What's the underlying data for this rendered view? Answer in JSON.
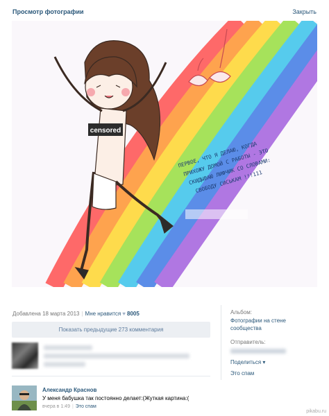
{
  "header": {
    "title": "Просмотр фотографии",
    "close_label": "Закрыть"
  },
  "photo": {
    "censored_label": "censored",
    "caption_lines": [
      "ПЕРВОЕ, ЧТО Я ДЕЛАЮ, КОГДА",
      "ПРИХОЖУ ДОМОЙ С РАБОТЫ - ЭТО",
      "СКИДЫВАЮ ЛИФЧИК СО СЛОВАМИ:",
      "СВОБОДУ СИСЬКАМ !!!111"
    ]
  },
  "meta": {
    "added": "Добавлена 18 марта 2013",
    "like_label": "Мне нравится",
    "like_count": "8005"
  },
  "comments": {
    "show_previous": "Показать предыдущие 273 комментария",
    "items": [
      {
        "author": "Александр Краснов",
        "text": "У меня бабушка так постоянно делает:(Жуткая картина:(",
        "time": "вчера в 1:49",
        "spam_label": "Это спам"
      }
    ]
  },
  "sidebar": {
    "album_label": "Альбом:",
    "album_name_1": "Фотографии на стене",
    "album_name_2": "сообщества",
    "sender_label": "Отправитель:",
    "share_label": "Поделиться",
    "spam_label": "Это спам"
  },
  "watermark": "pikabu.ru",
  "colors": {
    "link": "#2b587a",
    "button_bg": "#eceff3",
    "muted": "#777777"
  }
}
